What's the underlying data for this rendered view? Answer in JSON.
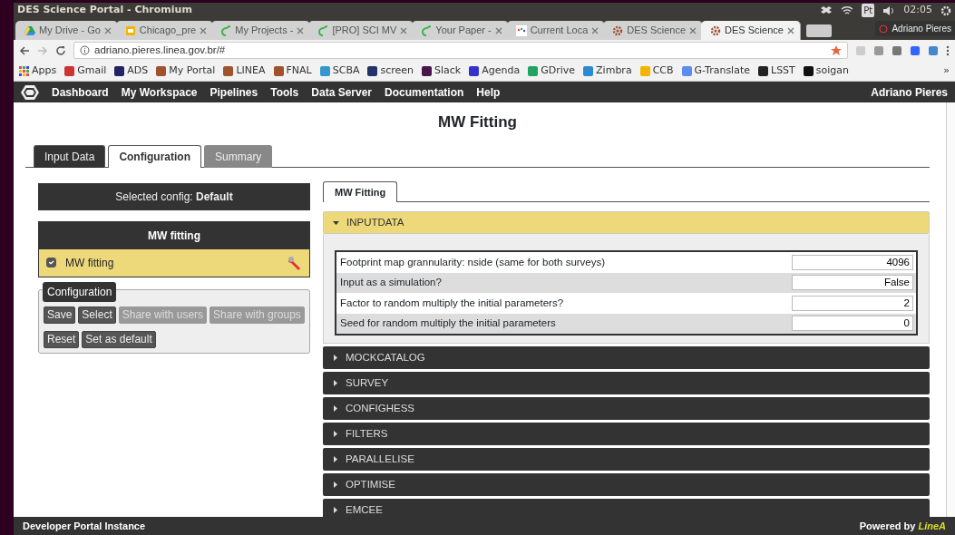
{
  "window": {
    "title": "DES Science Portal - Chromium"
  },
  "system_tray": {
    "keyboard": "Pt",
    "time": "02:05"
  },
  "browser": {
    "tabs": [
      {
        "label": "My Drive - Go",
        "selected": false
      },
      {
        "label": "Chicago_pre",
        "selected": false
      },
      {
        "label": "My Projects -",
        "selected": false
      },
      {
        "label": "[PRO] SCI MV",
        "selected": false
      },
      {
        "label": "Your Paper -",
        "selected": false
      },
      {
        "label": "Current Loca",
        "selected": false
      },
      {
        "label": "DES Science",
        "selected": false
      },
      {
        "label": "DES Science",
        "selected": true
      }
    ],
    "profile": "Adriano Pieres",
    "address": "adriano.pieres.linea.gov.br/#",
    "bookmarks": [
      "Apps",
      "Gmail",
      "ADS",
      "My Portal",
      "LINEA",
      "FNAL",
      "SCBA",
      "screen",
      "Slack",
      "Agenda",
      "GDrive",
      "Zimbra",
      "CCB",
      "G-Translate",
      "LSST",
      "soigan"
    ],
    "more": "»"
  },
  "navbar": {
    "items": [
      "Dashboard",
      "My Workspace",
      "Pipelines",
      "Tools",
      "Data Server",
      "Documentation",
      "Help"
    ],
    "user": "Adriano Pieres"
  },
  "page": {
    "title": "MW Fitting",
    "tabs": [
      {
        "label": "Input Data",
        "selected": false,
        "disabled": false
      },
      {
        "label": "Configuration",
        "selected": true,
        "disabled": false
      },
      {
        "label": "Summary",
        "selected": false,
        "disabled": true
      }
    ],
    "selected_config": "Selected config: **Default**",
    "pipeline": {
      "header": "MW fitting",
      "items": [
        {
          "label": "MW fitting",
          "checked": true
        }
      ]
    },
    "configuration": {
      "legend": "Configuration",
      "buttons": [
        {
          "label": "Save",
          "disabled": false
        },
        {
          "label": "Select",
          "disabled": false
        },
        {
          "label": "Share with users",
          "disabled": true
        },
        {
          "label": "Share with groups",
          "disabled": true
        },
        {
          "label": "Reset",
          "disabled": false
        },
        {
          "label": "Set as default",
          "disabled": false
        }
      ]
    },
    "section_tabs": [
      {
        "label": "MW Fitting",
        "selected": true
      }
    ],
    "sections": [
      {
        "title": "INPUTDATA",
        "expanded": true,
        "params": [
          {
            "label": "Footprint map grannularity: nside (same for both surveys)",
            "value": "4096"
          },
          {
            "label": "Input as a simulation?",
            "value": "False"
          },
          {
            "label": "Factor to random multiply the initial parameters?",
            "value": "2"
          },
          {
            "label": "Seed for random multiply the initial parameters",
            "value": "0"
          }
        ]
      },
      {
        "title": "MOCKCATALOG",
        "expanded": false
      },
      {
        "title": "SURVEY",
        "expanded": false
      },
      {
        "title": "CONFIGHESS",
        "expanded": false
      },
      {
        "title": "FILTERS",
        "expanded": false
      },
      {
        "title": "PARALLELISE",
        "expanded": false
      },
      {
        "title": "OPTIMISE",
        "expanded": false
      },
      {
        "title": "EMCEE",
        "expanded": false
      }
    ]
  },
  "footer": {
    "left": "Developer Portal Instance",
    "powered_by": "Powered by",
    "brand": "LineA"
  }
}
